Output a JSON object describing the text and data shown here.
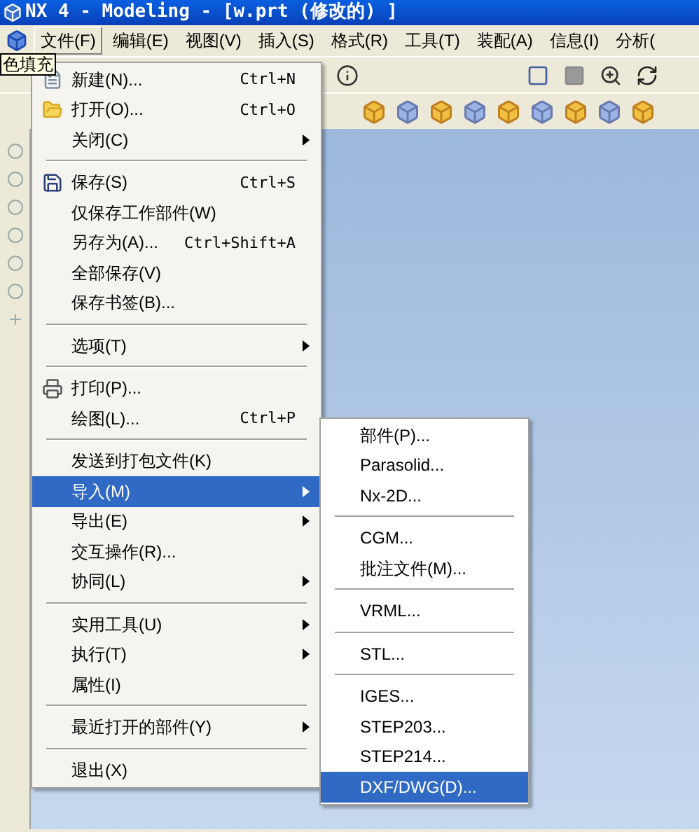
{
  "window": {
    "title": "NX 4 - Modeling - [w.prt (修改的) ]"
  },
  "menubar": [
    {
      "label": "文件(F)",
      "selected": true
    },
    {
      "label": "编辑(E)",
      "selected": false
    },
    {
      "label": "视图(V)",
      "selected": false
    },
    {
      "label": "插入(S)",
      "selected": false
    },
    {
      "label": "格式(R)",
      "selected": false
    },
    {
      "label": "工具(T)",
      "selected": false
    },
    {
      "label": "装配(A)",
      "selected": false
    },
    {
      "label": "信息(I)",
      "selected": false
    },
    {
      "label": "分析(",
      "selected": false
    }
  ],
  "tooltip": "色填充",
  "file_menu": [
    {
      "kind": "item",
      "label": "新建(N)...",
      "shortcut": "Ctrl+N",
      "selected": false
    },
    {
      "kind": "item",
      "label": "打开(O)...",
      "shortcut": "Ctrl+O",
      "selected": false
    },
    {
      "kind": "item",
      "label": "关闭(C)",
      "submenu": true,
      "selected": false
    },
    {
      "kind": "separator"
    },
    {
      "kind": "item",
      "label": "保存(S)",
      "shortcut": "Ctrl+S",
      "selected": false
    },
    {
      "kind": "item",
      "label": "仅保存工作部件(W)",
      "selected": false
    },
    {
      "kind": "item",
      "label": "另存为(A)...",
      "shortcut": "Ctrl+Shift+A",
      "selected": false
    },
    {
      "kind": "item",
      "label": "全部保存(V)",
      "selected": false
    },
    {
      "kind": "item",
      "label": "保存书签(B)...",
      "selected": false
    },
    {
      "kind": "separator"
    },
    {
      "kind": "item",
      "label": "选项(T)",
      "submenu": true,
      "selected": false
    },
    {
      "kind": "separator"
    },
    {
      "kind": "item",
      "label": "打印(P)...",
      "selected": false
    },
    {
      "kind": "item",
      "label": "绘图(L)...",
      "shortcut": "Ctrl+P",
      "selected": false
    },
    {
      "kind": "separator"
    },
    {
      "kind": "item",
      "label": "发送到打包文件(K)",
      "selected": false
    },
    {
      "kind": "item",
      "label": "导入(M)",
      "submenu": true,
      "selected": true
    },
    {
      "kind": "item",
      "label": "导出(E)",
      "submenu": true,
      "selected": false
    },
    {
      "kind": "item",
      "label": "交互操作(R)...",
      "selected": false
    },
    {
      "kind": "item",
      "label": "协同(L)",
      "submenu": true,
      "selected": false
    },
    {
      "kind": "separator"
    },
    {
      "kind": "item",
      "label": "实用工具(U)",
      "submenu": true,
      "selected": false
    },
    {
      "kind": "item",
      "label": "执行(T)",
      "submenu": true,
      "selected": false
    },
    {
      "kind": "item",
      "label": "属性(I)",
      "selected": false
    },
    {
      "kind": "separator"
    },
    {
      "kind": "item",
      "label": "最近打开的部件(Y)",
      "submenu": true,
      "selected": false
    },
    {
      "kind": "separator"
    },
    {
      "kind": "item",
      "label": "退出(X)",
      "selected": false
    }
  ],
  "import_submenu": [
    {
      "kind": "item",
      "label": "部件(P)...",
      "selected": false
    },
    {
      "kind": "item",
      "label": "Parasolid...",
      "selected": false
    },
    {
      "kind": "item",
      "label": "Nx-2D...",
      "selected": false
    },
    {
      "kind": "separator"
    },
    {
      "kind": "item",
      "label": "CGM...",
      "selected": false
    },
    {
      "kind": "item",
      "label": "批注文件(M)...",
      "selected": false
    },
    {
      "kind": "separator"
    },
    {
      "kind": "item",
      "label": "VRML...",
      "selected": false
    },
    {
      "kind": "separator"
    },
    {
      "kind": "item",
      "label": "STL...",
      "selected": false
    },
    {
      "kind": "separator"
    },
    {
      "kind": "item",
      "label": "IGES...",
      "selected": false
    },
    {
      "kind": "item",
      "label": "STEP203...",
      "selected": false
    },
    {
      "kind": "item",
      "label": "STEP214...",
      "selected": false
    },
    {
      "kind": "item",
      "label": "DXF/DWG(D)...",
      "selected": true
    }
  ]
}
